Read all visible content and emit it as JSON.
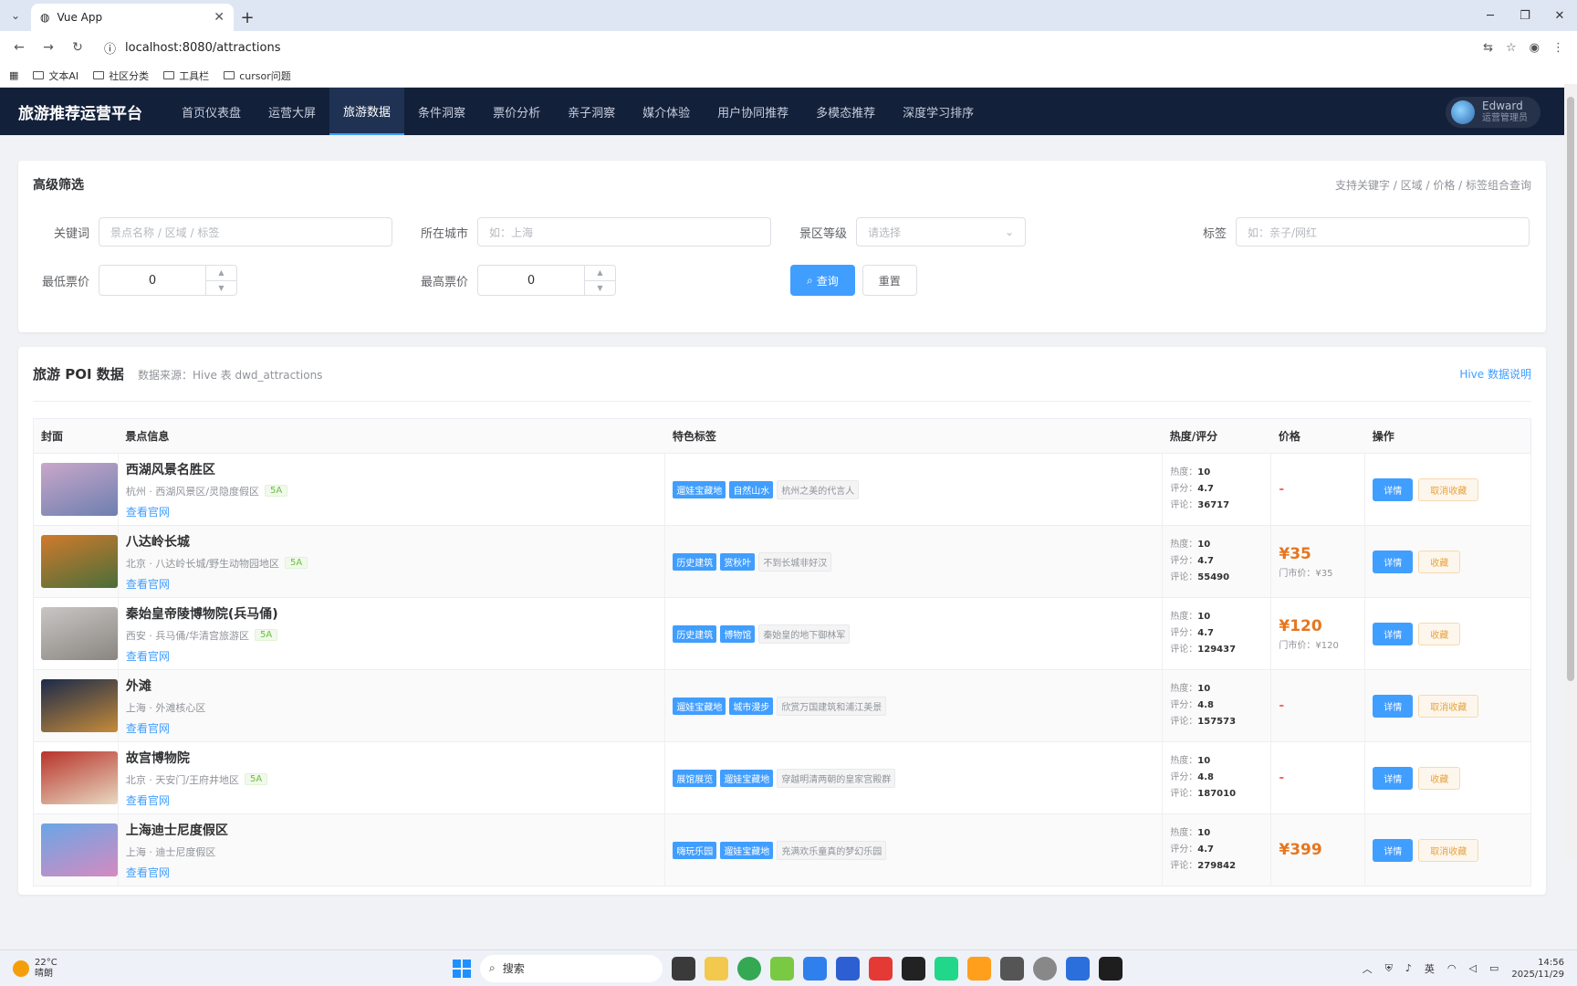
{
  "browser": {
    "tab_title": "Vue App",
    "url": "localhost:8080/attractions",
    "bookmarks": [
      "文本AI",
      "社区分类",
      "工具栏",
      "cursor问题"
    ]
  },
  "app": {
    "brand": "旅游推荐运营平台",
    "nav": [
      {
        "label": "首页仪表盘",
        "active": false
      },
      {
        "label": "运营大屏",
        "active": false
      },
      {
        "label": "旅游数据",
        "active": true
      },
      {
        "label": "条件洞察",
        "active": false
      },
      {
        "label": "票价分析",
        "active": false
      },
      {
        "label": "亲子洞察",
        "active": false
      },
      {
        "label": "媒介体验",
        "active": false
      },
      {
        "label": "用户协同推荐",
        "active": false
      },
      {
        "label": "多模态推荐",
        "active": false
      },
      {
        "label": "深度学习排序",
        "active": false
      }
    ],
    "user": {
      "name": "Edward",
      "role": "运营管理员"
    }
  },
  "filter": {
    "title": "高级筛选",
    "hint": "支持关键字 / 区域 / 价格 / 标签组合查询",
    "keyword_label": "关键词",
    "keyword_placeholder": "景点名称 / 区域 / 标签",
    "city_label": "所在城市",
    "city_placeholder": "如：上海",
    "grade_label": "景区等级",
    "grade_placeholder": "请选择",
    "tag_label": "标签",
    "tag_placeholder": "如：亲子/网红",
    "min_price_label": "最低票价",
    "min_price_value": "0",
    "max_price_label": "最高票价",
    "max_price_value": "0",
    "search_button": "查询",
    "reset_button": "重置"
  },
  "data": {
    "title": "旅游 POI 数据",
    "source": "数据来源：Hive 表 dwd_attractions",
    "link": "Hive 数据说明",
    "columns": [
      "封面",
      "景点信息",
      "特色标签",
      "热度/评分",
      "价格",
      "操作"
    ],
    "stat_labels": {
      "heat": "热度：",
      "score": "评分：",
      "reviews": "评论："
    },
    "detail_label": "详情",
    "site_label": "查看官网",
    "rows": [
      {
        "name": "西湖风景名胜区",
        "location": "杭州 · 西湖风景区/灵隐度假区",
        "grade": "5A",
        "tags": [
          "遛娃宝藏地",
          "自然山水"
        ],
        "desc": "杭州之美的代言人",
        "heat": "10",
        "score": "4.7",
        "reviews": "36717",
        "price": "-",
        "market_price": "",
        "fav": "取消收藏",
        "cover": [
          "#c9a7c9",
          "#6d7fb0"
        ]
      },
      {
        "name": "八达岭长城",
        "location": "北京 · 八达岭长城/野生动物园地区",
        "grade": "5A",
        "tags": [
          "历史建筑",
          "赏秋叶"
        ],
        "desc": "不到长城非好汉",
        "heat": "10",
        "score": "4.7",
        "reviews": "55490",
        "price": "¥35",
        "market_price": "门市价：¥35",
        "fav": "收藏",
        "cover": [
          "#d07a2c",
          "#4a6e3a"
        ]
      },
      {
        "name": "秦始皇帝陵博物院(兵马俑)",
        "location": "西安 · 兵马俑/华清宫旅游区",
        "grade": "5A",
        "tags": [
          "历史建筑",
          "博物馆"
        ],
        "desc": "秦始皇的地下御林军",
        "heat": "10",
        "score": "4.7",
        "reviews": "129437",
        "price": "¥120",
        "market_price": "门市价：¥120",
        "fav": "收藏",
        "cover": [
          "#c8c6c4",
          "#8a8580"
        ]
      },
      {
        "name": "外滩",
        "location": "上海 · 外滩核心区",
        "grade": "",
        "tags": [
          "遛娃宝藏地",
          "城市漫步"
        ],
        "desc": "欣赏万国建筑和浦江美景",
        "heat": "10",
        "score": "4.8",
        "reviews": "157573",
        "price": "-",
        "market_price": "",
        "fav": "取消收藏",
        "cover": [
          "#1b2a4a",
          "#c58b3a"
        ]
      },
      {
        "name": "故宫博物院",
        "location": "北京 · 天安门/王府井地区",
        "grade": "5A",
        "tags": [
          "展馆展览",
          "遛娃宝藏地"
        ],
        "desc": "穿越明清两朝的皇家宫殿群",
        "heat": "10",
        "score": "4.8",
        "reviews": "187010",
        "price": "-",
        "market_price": "",
        "fav": "收藏",
        "cover": [
          "#b8332a",
          "#e8d9c2"
        ]
      },
      {
        "name": "上海迪士尼度假区",
        "location": "上海 · 迪士尼度假区",
        "grade": "",
        "tags": [
          "嗨玩乐园",
          "遛娃宝藏地"
        ],
        "desc": "充满欢乐童真的梦幻乐园",
        "heat": "10",
        "score": "4.7",
        "reviews": "279842",
        "price": "¥399",
        "market_price": "",
        "fav": "取消收藏",
        "cover": [
          "#6aa6e6",
          "#d58ac0"
        ]
      }
    ]
  },
  "taskbar": {
    "temp": "22°C",
    "weather": "晴朗",
    "search": "搜索",
    "lang": "英",
    "time": "14:56",
    "date": "2025/11/29"
  },
  "colors": {
    "header_bg": "#13203a",
    "primary": "#409eff",
    "price": "#e6761f",
    "fav": "#e6a23c"
  }
}
